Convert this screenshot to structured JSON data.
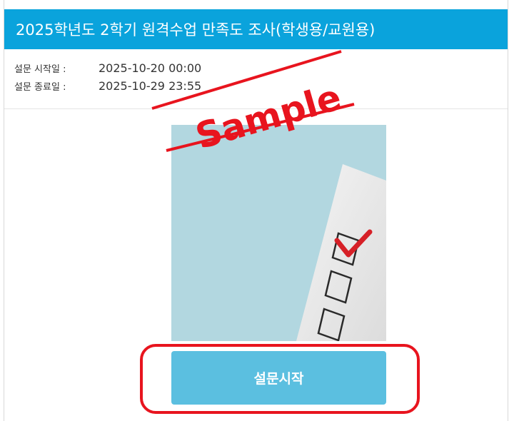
{
  "survey": {
    "title": "2025학년도 2학기 원격수업 만족도 조사(학생용/교원용)",
    "start_label": "설문 시작일 :",
    "start_value": "2025-10-20 00:00",
    "end_label": "설문 종료일 :",
    "end_value": "2025-10-29 23:55",
    "start_button_label": "설문시작"
  },
  "watermark": {
    "text": "Sample"
  },
  "colors": {
    "header_bg": "#0aa3dc",
    "button_bg": "#5bbfe0",
    "highlight": "#e8141e",
    "checkmark": "#d62027"
  },
  "image": {
    "subject": "checklist-illustration"
  }
}
